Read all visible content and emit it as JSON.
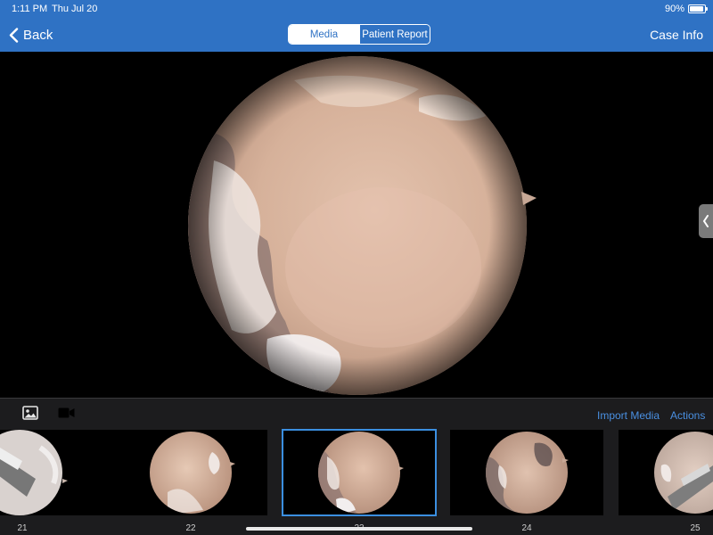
{
  "status_bar": {
    "time": "1:11 PM",
    "date": "Thu Jul 20",
    "battery_percent": "90%",
    "battery_level": 0.9
  },
  "nav": {
    "back_label": "Back",
    "tabs": [
      {
        "label": "Media",
        "selected": true
      },
      {
        "label": "Patient Report",
        "selected": false
      }
    ],
    "case_info_label": "Case Info"
  },
  "toolbar": {
    "photo_icon": "photo-icon",
    "video_icon": "video-camera-icon",
    "import_media_label": "Import Media",
    "actions_label": "Actions"
  },
  "thumbnails": [
    {
      "number": "21",
      "selected": false
    },
    {
      "number": "22",
      "selected": false
    },
    {
      "number": "23",
      "selected": true
    },
    {
      "number": "24",
      "selected": false
    },
    {
      "number": "25",
      "selected": false
    }
  ],
  "colors": {
    "header_blue": "#2f72c4",
    "accent_link": "#4a90e2",
    "selection_outline": "#3b8fe0",
    "panel_background": "#1c1c1e"
  }
}
